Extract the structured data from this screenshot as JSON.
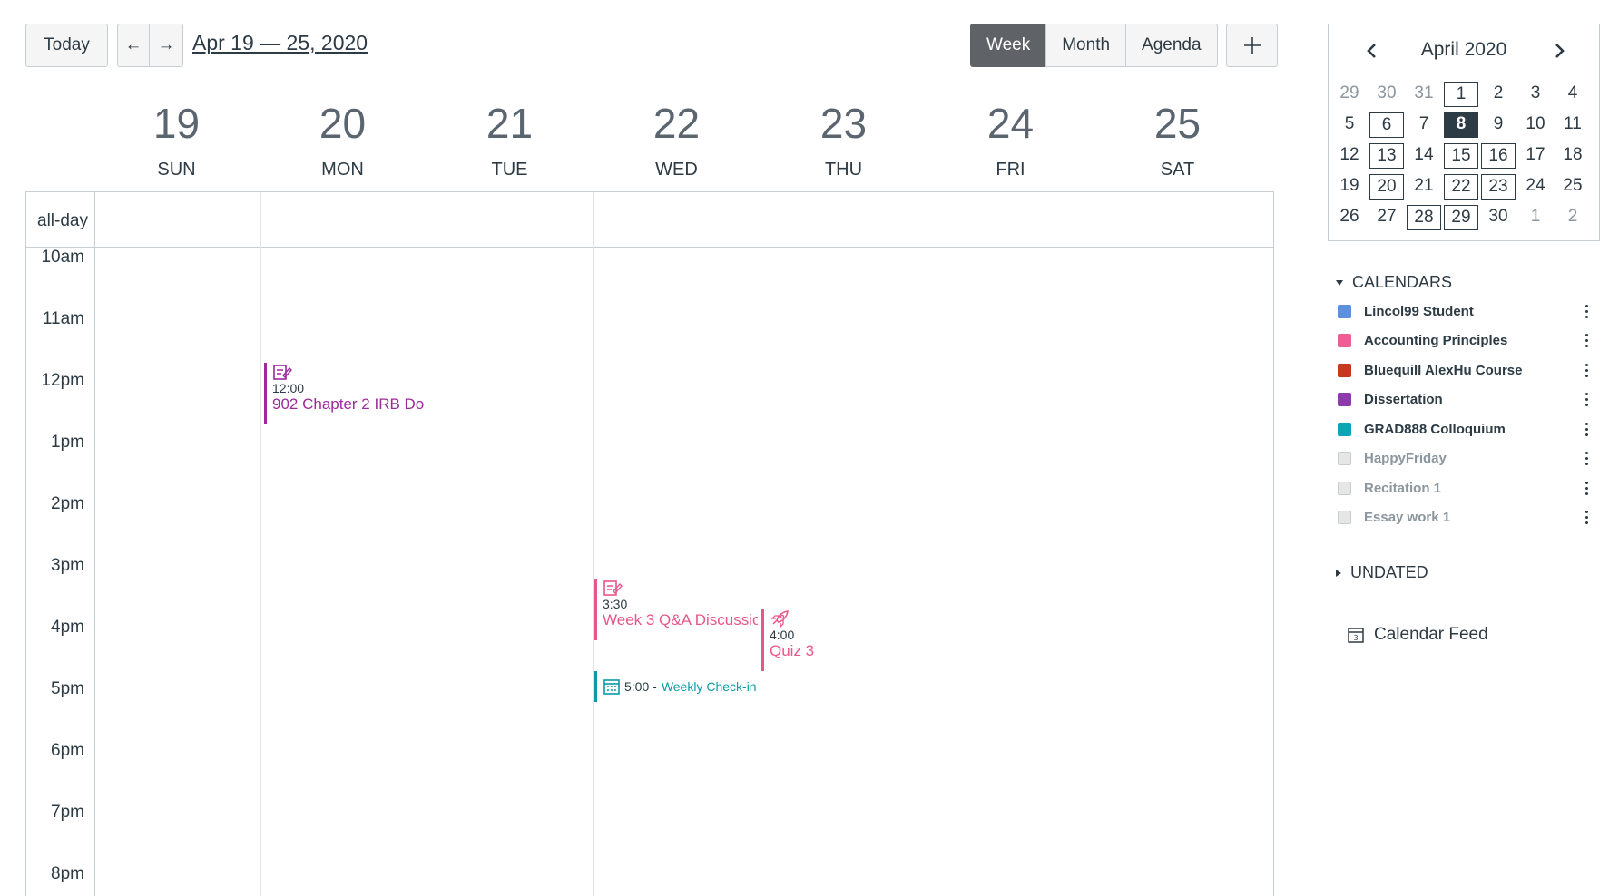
{
  "toolbar": {
    "today_label": "Today",
    "prev_arrow": "←",
    "next_arrow": "→",
    "date_range": "Apr 19 — 25, 2020",
    "views": [
      "Week",
      "Month",
      "Agenda"
    ],
    "active_view": "Week",
    "add_icon": "plus-icon"
  },
  "days": [
    {
      "num": "19",
      "name": "SUN"
    },
    {
      "num": "20",
      "name": "MON"
    },
    {
      "num": "21",
      "name": "TUE"
    },
    {
      "num": "22",
      "name": "WED"
    },
    {
      "num": "23",
      "name": "THU"
    },
    {
      "num": "24",
      "name": "FRI"
    },
    {
      "num": "25",
      "name": "SAT"
    }
  ],
  "allday_label": "all-day",
  "times": [
    "10am",
    "11am",
    "12pm",
    "1pm",
    "2pm",
    "3pm",
    "4pm",
    "5pm",
    "6pm",
    "7pm",
    "8pm"
  ],
  "events": [
    {
      "day": "MON",
      "time": "12:00",
      "title": "902 Chapter 2 IRB Do",
      "color": "#9b2a9b",
      "icon": "assignment-icon"
    },
    {
      "day": "WED",
      "time": "3:30",
      "title": "Week 3 Q&A Discussio",
      "color": "#e8578a",
      "icon": "assignment-icon"
    },
    {
      "day": "WED",
      "time": "5:00 -",
      "title": "Weekly Check-in",
      "color": "#0b9aa8",
      "icon": "calendar-event-icon"
    },
    {
      "day": "THU",
      "time": "4:00",
      "title": "Quiz 3",
      "color": "#e8578a",
      "icon": "quiz-rocket-icon"
    }
  ],
  "minical": {
    "title": "April 2020",
    "prev_icon": "chevron-left-icon",
    "next_icon": "chevron-right-icon",
    "weeks": [
      [
        "29",
        "30",
        "31",
        "1",
        "2",
        "3",
        "4"
      ],
      [
        "5",
        "6",
        "7",
        "8",
        "9",
        "10",
        "11"
      ],
      [
        "12",
        "13",
        "14",
        "15",
        "16",
        "17",
        "18"
      ],
      [
        "19",
        "20",
        "21",
        "22",
        "23",
        "24",
        "25"
      ],
      [
        "26",
        "27",
        "28",
        "29",
        "30",
        "1",
        "2"
      ]
    ]
  },
  "calendars_heading": "CALENDARS",
  "calendars": [
    {
      "name": "Lincol99 Student",
      "color": "#5b8fe0",
      "enabled": true
    },
    {
      "name": "Accounting Principles",
      "color": "#ee5f95",
      "enabled": true
    },
    {
      "name": "Bluequill AlexHu Course",
      "color": "#c6391e",
      "enabled": true
    },
    {
      "name": "Dissertation",
      "color": "#8e3aad",
      "enabled": true
    },
    {
      "name": "GRAD888 Colloquium",
      "color": "#0ca5b6",
      "enabled": true
    },
    {
      "name": "HappyFriday",
      "color": "#e6e6e6",
      "enabled": false
    },
    {
      "name": "Recitation 1",
      "color": "#e6e6e6",
      "enabled": false
    },
    {
      "name": "Essay work 1",
      "color": "#e6e6e6",
      "enabled": false
    }
  ],
  "undated_heading": "UNDATED",
  "feed_label": "Calendar Feed"
}
